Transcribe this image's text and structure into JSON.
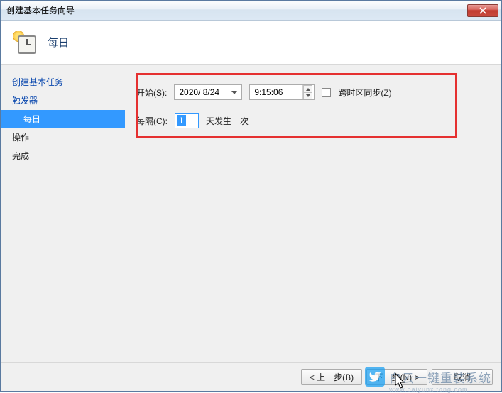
{
  "window": {
    "title": "创建基本任务向导"
  },
  "header": {
    "title": "每日"
  },
  "sidebar": {
    "items": [
      {
        "label": "创建基本任务",
        "link": true,
        "selected": false,
        "indent": false
      },
      {
        "label": "触发器",
        "link": true,
        "selected": false,
        "indent": false
      },
      {
        "label": "每日",
        "link": false,
        "selected": true,
        "indent": true
      },
      {
        "label": "操作",
        "link": false,
        "selected": false,
        "indent": false
      },
      {
        "label": "完成",
        "link": false,
        "selected": false,
        "indent": false
      }
    ]
  },
  "form": {
    "start_label": "开始(S):",
    "date_value": "2020/ 8/24",
    "time_value": "9:15:06",
    "sync_label": "跨时区同步(Z)",
    "sync_checked": false,
    "interval_label": "每隔(C):",
    "interval_value": "1",
    "interval_suffix": "天发生一次"
  },
  "footer": {
    "back": "< 上一步(B)",
    "next": "下一步(N) >",
    "cancel": "取消"
  },
  "watermark": {
    "text": "白云一键重装系统",
    "sub": "www.baiyunxitong.com"
  }
}
